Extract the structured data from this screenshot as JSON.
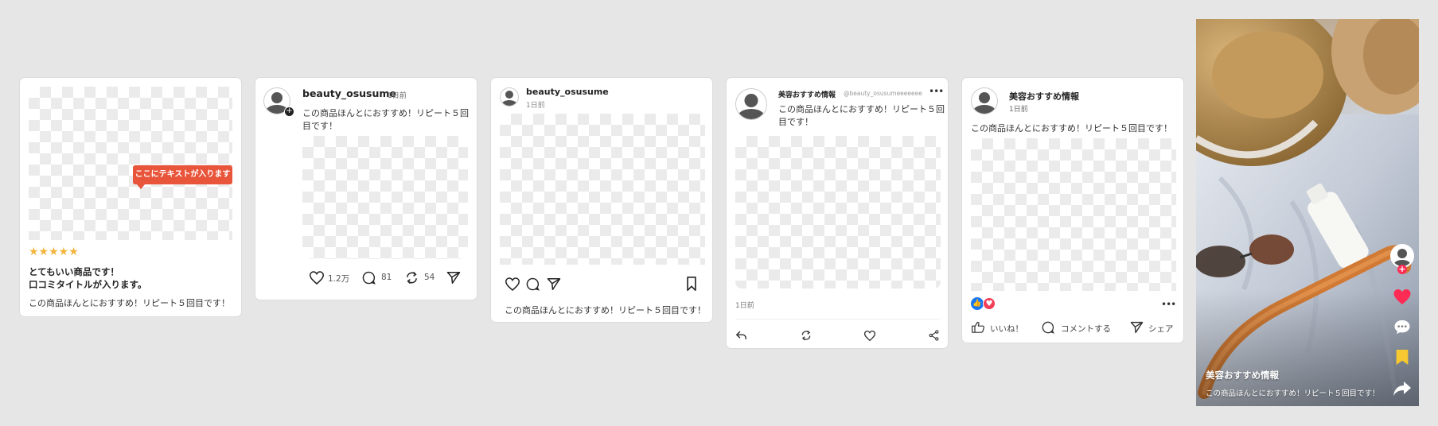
{
  "review_card": {
    "stars": "★★★★★",
    "tooltip": "ここにテキストが入ります",
    "title_line1": "とてもいい商品です！",
    "title_line2": "口コミタイトルが入ります。",
    "body": "この商品ほんとにおすすめ！リピート５回目です！"
  },
  "x_card": {
    "username": "beauty_osusume",
    "time": "1日前",
    "text_line1": "この商品ほんとにおすすめ！リピート５回",
    "text_line2": "目です！",
    "likes": "1.2万",
    "comments": "81",
    "reposts": "54"
  },
  "insta_card": {
    "username": "beauty_osusume",
    "time": "1日前",
    "caption": "この商品ほんとにおすすめ！リピート５回目です！"
  },
  "threads_card": {
    "name": "美容おすすめ情報",
    "handle": "@beauty_osusumeeeeeee",
    "text_line1": "この商品ほんとにおすすめ！リピート５回",
    "text_line2": "目です！",
    "time": "1日前"
  },
  "fb_card": {
    "name": "美容おすすめ情報",
    "time": "1日前",
    "text": "この商品ほんとにおすすめ！リピート５回目です！",
    "like_label": "いいね！",
    "comment_label": "コメントする",
    "share_label": "シェア"
  },
  "tiktok_card": {
    "name": "美容おすすめ情報",
    "caption": "この商品ほんとにおすすめ！リピート５回目です！"
  },
  "colors": {
    "orange": "#e8553a",
    "star": "#f2b43c",
    "heart": "#fe2c55",
    "bookmark": "#f7c82f",
    "fb_blue": "#1877f2",
    "fb_red": "#f33e58"
  }
}
